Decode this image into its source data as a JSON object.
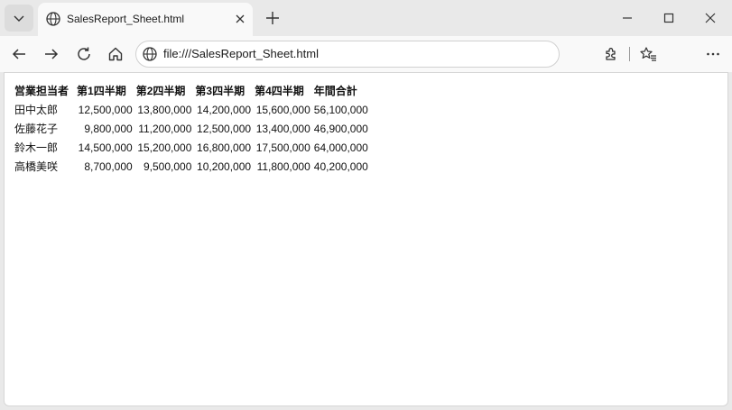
{
  "browser": {
    "tab": {
      "title": "SalesReport_Sheet.html",
      "icon": "globe-icon"
    },
    "address": {
      "url": "file:///SalesReport_Sheet.html"
    },
    "toolbar_icons": [
      "back-icon",
      "forward-icon",
      "refresh-icon",
      "home-icon",
      "extensions-icon",
      "favorites-icon",
      "more-icon"
    ],
    "window_controls": [
      "minimize-icon",
      "maximize-icon",
      "close-icon"
    ]
  },
  "table": {
    "headers": [
      "営業担当者",
      "第1四半期",
      "第2四半期",
      "第3四半期",
      "第4四半期",
      "年間合計"
    ],
    "rows": [
      {
        "name": "田中太郎",
        "q1": "12,500,000",
        "q2": "13,800,000",
        "q3": "14,200,000",
        "q4": "15,600,000",
        "total": "56,100,000"
      },
      {
        "name": "佐藤花子",
        "q1": "9,800,000",
        "q2": "11,200,000",
        "q3": "12,500,000",
        "q4": "13,400,000",
        "total": "46,900,000"
      },
      {
        "name": "鈴木一郎",
        "q1": "14,500,000",
        "q2": "15,200,000",
        "q3": "16,800,000",
        "q4": "17,500,000",
        "total": "64,000,000"
      },
      {
        "name": "高橋美咲",
        "q1": "8,700,000",
        "q2": "9,500,000",
        "q3": "10,200,000",
        "q4": "11,800,000",
        "total": "40,200,000"
      }
    ]
  }
}
